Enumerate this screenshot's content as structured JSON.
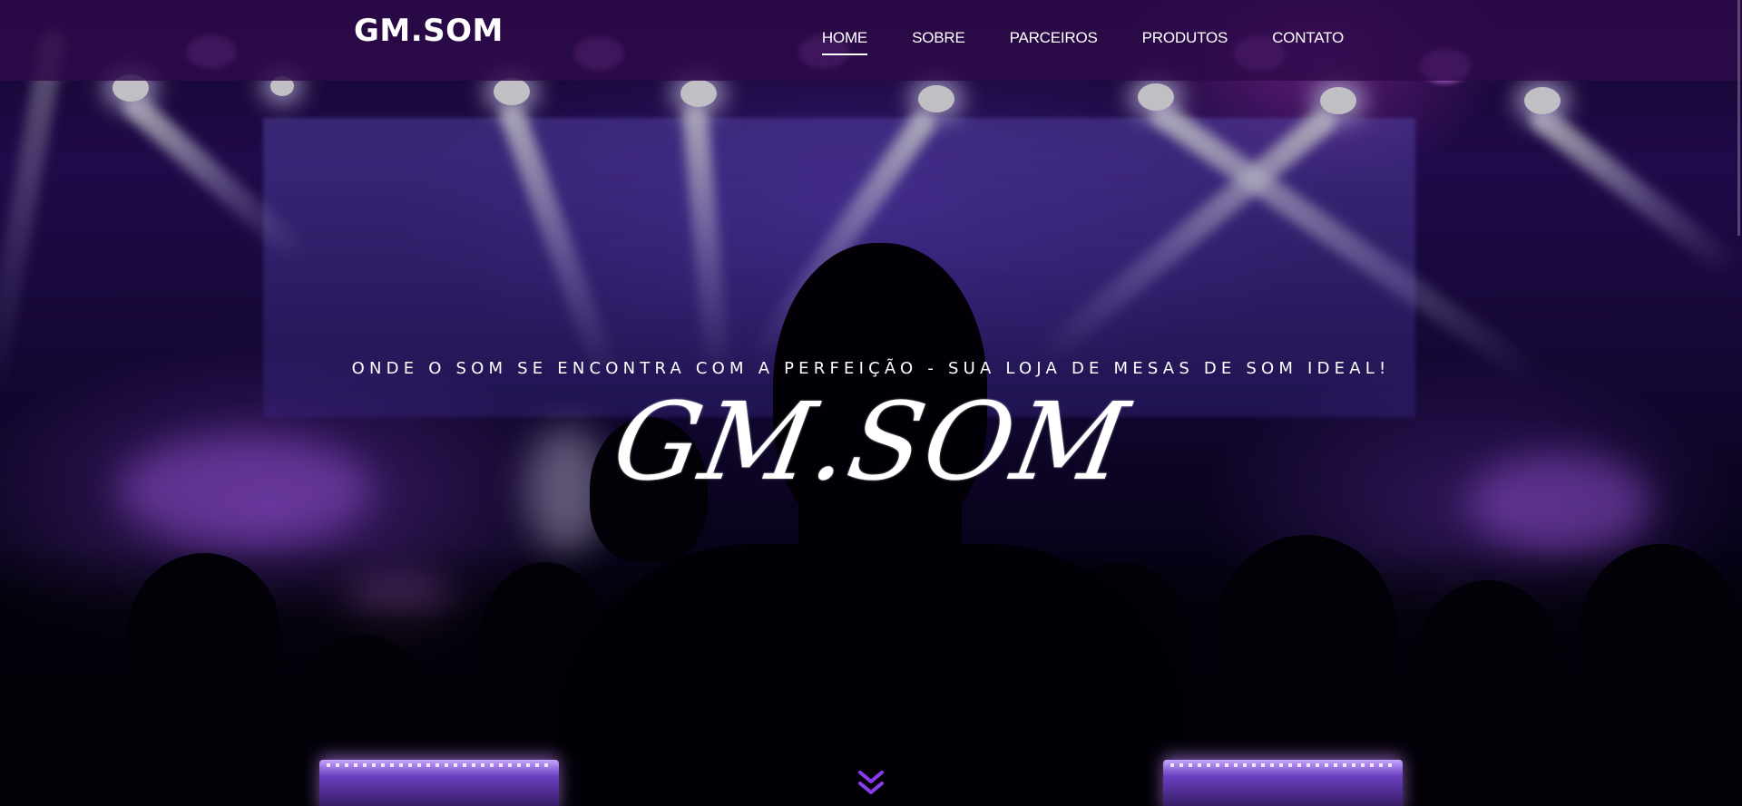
{
  "navbar": {
    "logo": "GM.SOM",
    "items": [
      {
        "label": "HOME",
        "active": true
      },
      {
        "label": "SOBRE",
        "active": false
      },
      {
        "label": "PARCEIROS",
        "active": false
      },
      {
        "label": "PRODUTOS",
        "active": false
      },
      {
        "label": "CONTATO",
        "active": false
      }
    ]
  },
  "hero": {
    "tagline": "ONDE O SOM SE ENCONTRA COM A PERFEIÇÃO - SUA LOJA DE MESAS DE SOM IDEAL!",
    "brand": "GM.SOM",
    "scroll_icon": "double-chevron-down-icon"
  },
  "colors": {
    "navbar_bg": "#2d0a4b",
    "accent": "#7b2ff2",
    "text": "#ffffff"
  }
}
